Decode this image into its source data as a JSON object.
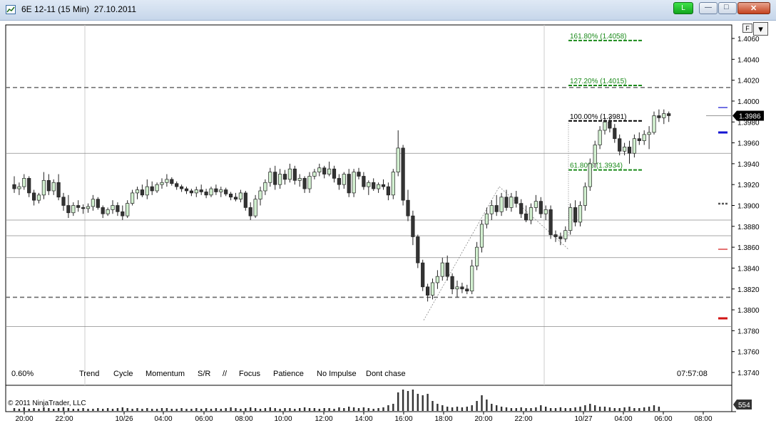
{
  "window": {
    "title": "6E 12-11 (15 Min)  27.10.2011",
    "link_button": "L",
    "min_glyph": "—",
    "max_glyph": "□",
    "close_glyph": "✕"
  },
  "toolbar": {
    "f_button": "F",
    "dropdown_glyph": "▾"
  },
  "footer": {
    "percent": "0.60%",
    "clock": "07:57:08",
    "copyright": "© 2011 NinjaTrader, LLC",
    "volume_badge": "554",
    "indicators": [
      "Trend",
      "Cycle",
      "Momentum",
      "S/R",
      "//",
      "Focus",
      "Patience",
      "No Impulse",
      "Dont chase"
    ]
  },
  "colors": {
    "up": "#d2f0d0",
    "down": "#333333",
    "fib": "#1a8a1a",
    "price_badge": "#000000",
    "dash": "#6a6a6a",
    "blue_marker": "#1414d2",
    "red_marker": "#d21414"
  },
  "chart_data": {
    "type": "candlestick",
    "instrument": "6E 12-11",
    "interval": "15 Min",
    "y_ticks": [
      "1.4060",
      "1.4040",
      "1.4020",
      "1.4000",
      "1.3980",
      "1.3960",
      "1.3940",
      "1.3920",
      "1.3900",
      "1.3880",
      "1.3860",
      "1.3840",
      "1.3820",
      "1.3800",
      "1.3780",
      "1.3760",
      "1.3740"
    ],
    "ylim": [
      1.374,
      1.406
    ],
    "last_price": "1.3986",
    "x_ticks": [
      "20:00",
      "22:00",
      "10/26",
      "04:00",
      "06:00",
      "08:00",
      "10:00",
      "12:00",
      "14:00",
      "16:00",
      "18:00",
      "20:00",
      "22:00",
      "10/27",
      "04:00",
      "06:00",
      "08:00"
    ],
    "fib_levels": [
      {
        "label": "161.80% (1.4058)",
        "price": 1.4058,
        "color": "green"
      },
      {
        "label": "127.20% (1.4015)",
        "price": 1.4015,
        "color": "green"
      },
      {
        "label": "100.00% (1.3981)",
        "price": 1.3981,
        "color": "black"
      },
      {
        "label": "61.80% (1.3934)",
        "price": 1.3934,
        "color": "green"
      }
    ],
    "dashed_levels": [
      1.4013,
      1.3812
    ],
    "sr_lines": [
      1.395,
      1.3886,
      1.3871,
      1.385,
      1.3784
    ],
    "candles": [
      [
        1.392,
        1.3928,
        1.3912,
        1.3916
      ],
      [
        1.3916,
        1.3922,
        1.391,
        1.3918
      ],
      [
        1.3918,
        1.393,
        1.3915,
        1.3926
      ],
      [
        1.3926,
        1.3928,
        1.3908,
        1.3912
      ],
      [
        1.3912,
        1.3915,
        1.39,
        1.3905
      ],
      [
        1.3905,
        1.3912,
        1.3902,
        1.391
      ],
      [
        1.391,
        1.3932,
        1.3906,
        1.3924
      ],
      [
        1.3924,
        1.393,
        1.391,
        1.3914
      ],
      [
        1.3914,
        1.3925,
        1.391,
        1.3922
      ],
      [
        1.3922,
        1.393,
        1.3905,
        1.3908
      ],
      [
        1.3908,
        1.3912,
        1.3895,
        1.39
      ],
      [
        1.39,
        1.391,
        1.3888,
        1.3893
      ],
      [
        1.3893,
        1.3903,
        1.389,
        1.39
      ],
      [
        1.39,
        1.3905,
        1.3894,
        1.3898
      ],
      [
        1.3898,
        1.3901,
        1.3892,
        1.3897
      ],
      [
        1.3897,
        1.3902,
        1.3893,
        1.3899
      ],
      [
        1.3899,
        1.391,
        1.3895,
        1.3906
      ],
      [
        1.3906,
        1.3908,
        1.3896,
        1.3898
      ],
      [
        1.3898,
        1.39,
        1.3888,
        1.3892
      ],
      [
        1.3892,
        1.3898,
        1.389,
        1.3896
      ],
      [
        1.3896,
        1.3905,
        1.3892,
        1.39
      ],
      [
        1.39,
        1.3903,
        1.389,
        1.3894
      ],
      [
        1.3894,
        1.39,
        1.3886,
        1.389
      ],
      [
        1.389,
        1.3905,
        1.3888,
        1.3902
      ],
      [
        1.3902,
        1.3915,
        1.39,
        1.3912
      ],
      [
        1.3912,
        1.3918,
        1.3906,
        1.3915
      ],
      [
        1.3915,
        1.392,
        1.3908,
        1.391
      ],
      [
        1.391,
        1.3925,
        1.3906,
        1.3918
      ],
      [
        1.3918,
        1.3923,
        1.391,
        1.3914
      ],
      [
        1.3914,
        1.3922,
        1.3912,
        1.392
      ],
      [
        1.392,
        1.3926,
        1.3916,
        1.3922
      ],
      [
        1.3922,
        1.393,
        1.3918,
        1.3925
      ],
      [
        1.3925,
        1.3927,
        1.3919,
        1.3921
      ],
      [
        1.3921,
        1.3923,
        1.3915,
        1.3918
      ],
      [
        1.3918,
        1.392,
        1.3913,
        1.3916
      ],
      [
        1.3916,
        1.3918,
        1.3911,
        1.3914
      ],
      [
        1.3914,
        1.3916,
        1.3909,
        1.3912
      ],
      [
        1.3912,
        1.3918,
        1.3908,
        1.3915
      ],
      [
        1.3915,
        1.392,
        1.391,
        1.3913
      ],
      [
        1.3913,
        1.3916,
        1.3907,
        1.391
      ],
      [
        1.391,
        1.3918,
        1.3908,
        1.3916
      ],
      [
        1.3916,
        1.392,
        1.391,
        1.3913
      ],
      [
        1.3913,
        1.3918,
        1.3908,
        1.3915
      ],
      [
        1.3915,
        1.3917,
        1.3909,
        1.3911
      ],
      [
        1.3911,
        1.3913,
        1.3905,
        1.3908
      ],
      [
        1.3908,
        1.3912,
        1.3904,
        1.3906
      ],
      [
        1.3906,
        1.3915,
        1.3903,
        1.3912
      ],
      [
        1.3912,
        1.3914,
        1.3895,
        1.3898
      ],
      [
        1.3898,
        1.3903,
        1.3886,
        1.389
      ],
      [
        1.389,
        1.391,
        1.3888,
        1.3906
      ],
      [
        1.3906,
        1.3918,
        1.39,
        1.3914
      ],
      [
        1.3914,
        1.3925,
        1.391,
        1.3922
      ],
      [
        1.3922,
        1.3936,
        1.3918,
        1.3932
      ],
      [
        1.3932,
        1.3938,
        1.3915,
        1.392
      ],
      [
        1.392,
        1.3935,
        1.3916,
        1.393
      ],
      [
        1.393,
        1.3934,
        1.392,
        1.3925
      ],
      [
        1.3925,
        1.394,
        1.3922,
        1.3935
      ],
      [
        1.3935,
        1.3938,
        1.392,
        1.3924
      ],
      [
        1.3924,
        1.393,
        1.3918,
        1.3926
      ],
      [
        1.3926,
        1.3928,
        1.3912,
        1.3916
      ],
      [
        1.3916,
        1.3932,
        1.3912,
        1.3928
      ],
      [
        1.3928,
        1.3935,
        1.3925,
        1.3932
      ],
      [
        1.3932,
        1.394,
        1.3928,
        1.3936
      ],
      [
        1.3936,
        1.3938,
        1.3926,
        1.393
      ],
      [
        1.393,
        1.3942,
        1.3928,
        1.3935
      ],
      [
        1.3935,
        1.3938,
        1.3922,
        1.3926
      ],
      [
        1.3926,
        1.393,
        1.3915,
        1.392
      ],
      [
        1.392,
        1.3932,
        1.3916,
        1.393
      ],
      [
        1.393,
        1.3935,
        1.3908,
        1.3912
      ],
      [
        1.3912,
        1.3935,
        1.3908,
        1.3932
      ],
      [
        1.3932,
        1.3936,
        1.3925,
        1.3928
      ],
      [
        1.3928,
        1.3932,
        1.3915,
        1.3918
      ],
      [
        1.3918,
        1.3924,
        1.391,
        1.3922
      ],
      [
        1.3922,
        1.3926,
        1.3914,
        1.3916
      ],
      [
        1.3916,
        1.3922,
        1.3912,
        1.392
      ],
      [
        1.392,
        1.3925,
        1.3915,
        1.3918
      ],
      [
        1.3918,
        1.3922,
        1.3905,
        1.391
      ],
      [
        1.391,
        1.3935,
        1.3906,
        1.3932
      ],
      [
        1.3932,
        1.3972,
        1.3928,
        1.3955
      ],
      [
        1.3955,
        1.3958,
        1.39,
        1.3905
      ],
      [
        1.3905,
        1.3915,
        1.3885,
        1.389
      ],
      [
        1.389,
        1.3895,
        1.3862,
        1.387
      ],
      [
        1.387,
        1.3872,
        1.384,
        1.3845
      ],
      [
        1.3845,
        1.3848,
        1.3818,
        1.3822
      ],
      [
        1.3822,
        1.3825,
        1.3808,
        1.3814
      ],
      [
        1.3814,
        1.383,
        1.381,
        1.3826
      ],
      [
        1.3826,
        1.3838,
        1.382,
        1.3832
      ],
      [
        1.3832,
        1.385,
        1.3828,
        1.3845
      ],
      [
        1.3845,
        1.3852,
        1.3828,
        1.3832
      ],
      [
        1.3832,
        1.3835,
        1.3815,
        1.382
      ],
      [
        1.382,
        1.3828,
        1.3812,
        1.3822
      ],
      [
        1.3822,
        1.3826,
        1.3816,
        1.382
      ],
      [
        1.382,
        1.3824,
        1.3815,
        1.3818
      ],
      [
        1.3818,
        1.3848,
        1.3815,
        1.3842
      ],
      [
        1.3842,
        1.3865,
        1.3838,
        1.386
      ],
      [
        1.386,
        1.3886,
        1.3855,
        1.3882
      ],
      [
        1.3882,
        1.3898,
        1.3878,
        1.3892
      ],
      [
        1.3892,
        1.3905,
        1.3886,
        1.39
      ],
      [
        1.39,
        1.391,
        1.389,
        1.3894
      ],
      [
        1.3894,
        1.3912,
        1.389,
        1.3908
      ],
      [
        1.3908,
        1.3915,
        1.3895,
        1.3898
      ],
      [
        1.3898,
        1.3912,
        1.3894,
        1.3908
      ],
      [
        1.3908,
        1.3914,
        1.3898,
        1.3902
      ],
      [
        1.3902,
        1.3906,
        1.3888,
        1.3892
      ],
      [
        1.3892,
        1.39,
        1.3884,
        1.3886
      ],
      [
        1.3886,
        1.3902,
        1.3882,
        1.3898
      ],
      [
        1.3898,
        1.391,
        1.3894,
        1.3904
      ],
      [
        1.3904,
        1.3908,
        1.3888,
        1.3892
      ],
      [
        1.3892,
        1.39,
        1.3886,
        1.3896
      ],
      [
        1.3896,
        1.39,
        1.3868,
        1.3872
      ],
      [
        1.3872,
        1.3876,
        1.3865,
        1.387
      ],
      [
        1.387,
        1.3874,
        1.3862,
        1.3868
      ],
      [
        1.3868,
        1.388,
        1.3865,
        1.3876
      ],
      [
        1.3876,
        1.3902,
        1.3872,
        1.3898
      ],
      [
        1.3898,
        1.3905,
        1.388,
        1.3884
      ],
      [
        1.3884,
        1.3904,
        1.388,
        1.39
      ],
      [
        1.39,
        1.3922,
        1.3895,
        1.3918
      ],
      [
        1.3918,
        1.3945,
        1.3914,
        1.394
      ],
      [
        1.394,
        1.3962,
        1.3936,
        1.3958
      ],
      [
        1.3958,
        1.3976,
        1.3954,
        1.3972
      ],
      [
        1.3972,
        1.3984,
        1.3968,
        1.398
      ],
      [
        1.398,
        1.3985,
        1.397,
        1.3974
      ],
      [
        1.3974,
        1.3978,
        1.396,
        1.3964
      ],
      [
        1.3964,
        1.3968,
        1.3948,
        1.3952
      ],
      [
        1.3952,
        1.396,
        1.3948,
        1.3956
      ],
      [
        1.3956,
        1.3962,
        1.394,
        1.395
      ],
      [
        1.395,
        1.3968,
        1.3946,
        1.3964
      ],
      [
        1.3964,
        1.397,
        1.3958,
        1.3962
      ],
      [
        1.3962,
        1.3972,
        1.3958,
        1.3968
      ],
      [
        1.3968,
        1.3976,
        1.3954,
        1.397
      ],
      [
        1.397,
        1.399,
        1.3968,
        1.3986
      ],
      [
        1.3986,
        1.3992,
        1.398,
        1.3984
      ],
      [
        1.3984,
        1.3992,
        1.3978,
        1.3988
      ],
      [
        1.3988,
        1.399,
        1.398,
        1.3986
      ]
    ],
    "volume": [
      4,
      3,
      5,
      3,
      4,
      3,
      5,
      4,
      3,
      4,
      5,
      4,
      3,
      3,
      4,
      3,
      3,
      4,
      3,
      4,
      3,
      4,
      5,
      4,
      3,
      4,
      3,
      4,
      3,
      3,
      4,
      4,
      3,
      3,
      4,
      3,
      3,
      4,
      3,
      4,
      3,
      4,
      3,
      4,
      5,
      4,
      3,
      4,
      5,
      4,
      3,
      4,
      5,
      4,
      3,
      4,
      4,
      3,
      4,
      5,
      4,
      4,
      3,
      4,
      4,
      3,
      5,
      4,
      6,
      5,
      4,
      5,
      4,
      3,
      4,
      5,
      8,
      10,
      26,
      30,
      28,
      30,
      24,
      22,
      24,
      14,
      10,
      8,
      6,
      5,
      6,
      5,
      6,
      8,
      14,
      22,
      16,
      10,
      8,
      6,
      5,
      4,
      4,
      5,
      4,
      4,
      5,
      8,
      6,
      4,
      4,
      5,
      4,
      4,
      5,
      6,
      8,
      10,
      8,
      6,
      6,
      5,
      4,
      4,
      5,
      6,
      4,
      4,
      5,
      6,
      8,
      6
    ]
  }
}
